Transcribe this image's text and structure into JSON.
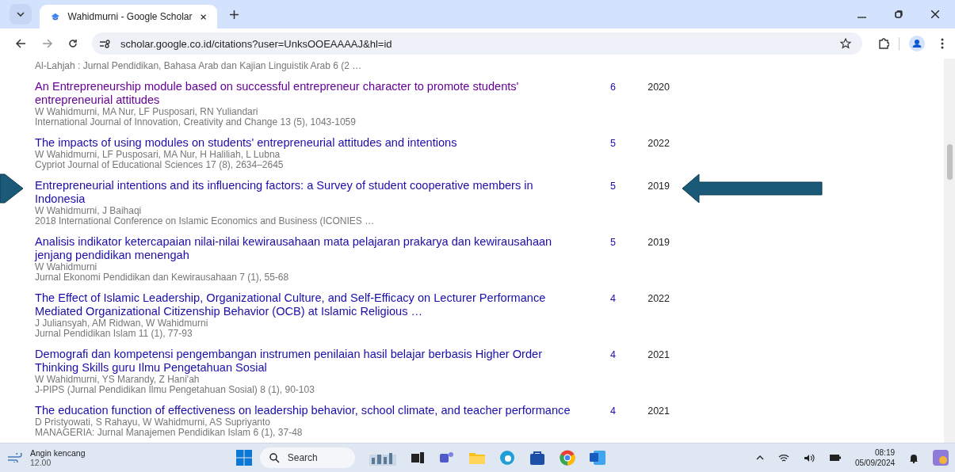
{
  "browser": {
    "tab": {
      "title": "Wahidmurni - Google Scholar",
      "selected": true
    },
    "url": "scholar.google.co.id/citations?user=UnksOOEAAAAJ&hl=id"
  },
  "partial_row": {
    "venue": "Al-Lahjah : Jurnal Pendidikan, Bahasa Arab dan Kajian Linguistik Arab 6 (2 …"
  },
  "articles": [
    {
      "title": "An Entrepreneurship module based on successful entrepreneur character to promote students' entrepreneurial attitudes",
      "authors": "W Wahidmurni, MA Nur, LF Pusposari, RN Yuliandari",
      "venue": "International Journal of Innovation, Creativity and Change 13 (5), 1043-1059",
      "cited_by": "6",
      "year": "2020",
      "visited": true,
      "arrow_marked": false
    },
    {
      "title": "The impacts of using modules on students' entrepreneurial attitudes and intentions",
      "authors": "W Wahidmurni, LF Pusposari, MA Nur, H Haliliah, L Lubna",
      "venue": "Cypriot Journal of Educational Sciences 17 (8), 2634–2645",
      "cited_by": "5",
      "year": "2022",
      "visited": false,
      "arrow_marked": false
    },
    {
      "title": "Entrepreneurial intentions and its influencing factors: a Survey of student cooperative members in Indonesia",
      "authors": "W Wahidmurni, J Baihaqi",
      "venue": "2018 International Conference on Islamic Economics and Business (ICONIES …",
      "cited_by": "5",
      "year": "2019",
      "visited": false,
      "arrow_marked": true
    },
    {
      "title": "Analisis indikator ketercapaian nilai-nilai kewirausahaan mata pelajaran prakarya dan kewirausahaan jenjang pendidikan menengah",
      "authors": "W Wahidmurni",
      "venue": "Jurnal Ekonomi Pendidikan dan Kewirausahaan 7 (1), 55-68",
      "cited_by": "5",
      "year": "2019",
      "visited": false,
      "arrow_marked": false
    },
    {
      "title": "The Effect of Islamic Leadership, Organizational Culture, and Self-Efficacy on Lecturer Performance Mediated Organizational Citizenship Behavior (OCB) at Islamic Religious …",
      "authors": "J Juliansyah, AM Ridwan, W Wahidmurni",
      "venue": "Jurnal Pendidikan Islam 11 (1), 77-93",
      "cited_by": "4",
      "year": "2022",
      "visited": false,
      "arrow_marked": false
    },
    {
      "title": "Demografi dan kompetensi pengembangan instrumen penilaian hasil belajar berbasis Higher Order Thinking Skills guru Ilmu Pengetahuan Sosial",
      "authors": "W Wahidmurni, YS Marandy, Z Hani'ah",
      "venue": "J-PIPS (Jurnal Pendidikan Ilmu Pengetahuan Sosial) 8 (1), 90-103",
      "cited_by": "4",
      "year": "2021",
      "visited": false,
      "arrow_marked": false
    },
    {
      "title": "The education function of effectiveness on leadership behavior, school climate, and teacher performance",
      "authors": "D Pristyowati, S Rahayu, W Wahidmurni, AS Supriyanto",
      "venue": "MANAGERIA: Jurnal Manajemen Pendidikan Islam 6 (1), 37-48",
      "cited_by": "4",
      "year": "2021",
      "visited": false,
      "arrow_marked": false
    }
  ],
  "taskbar": {
    "weather": {
      "label": "Angin kencang",
      "temp": "12.00"
    },
    "search": {
      "placeholder": "Search"
    },
    "time": "08:19",
    "date": "05/09/2024"
  }
}
